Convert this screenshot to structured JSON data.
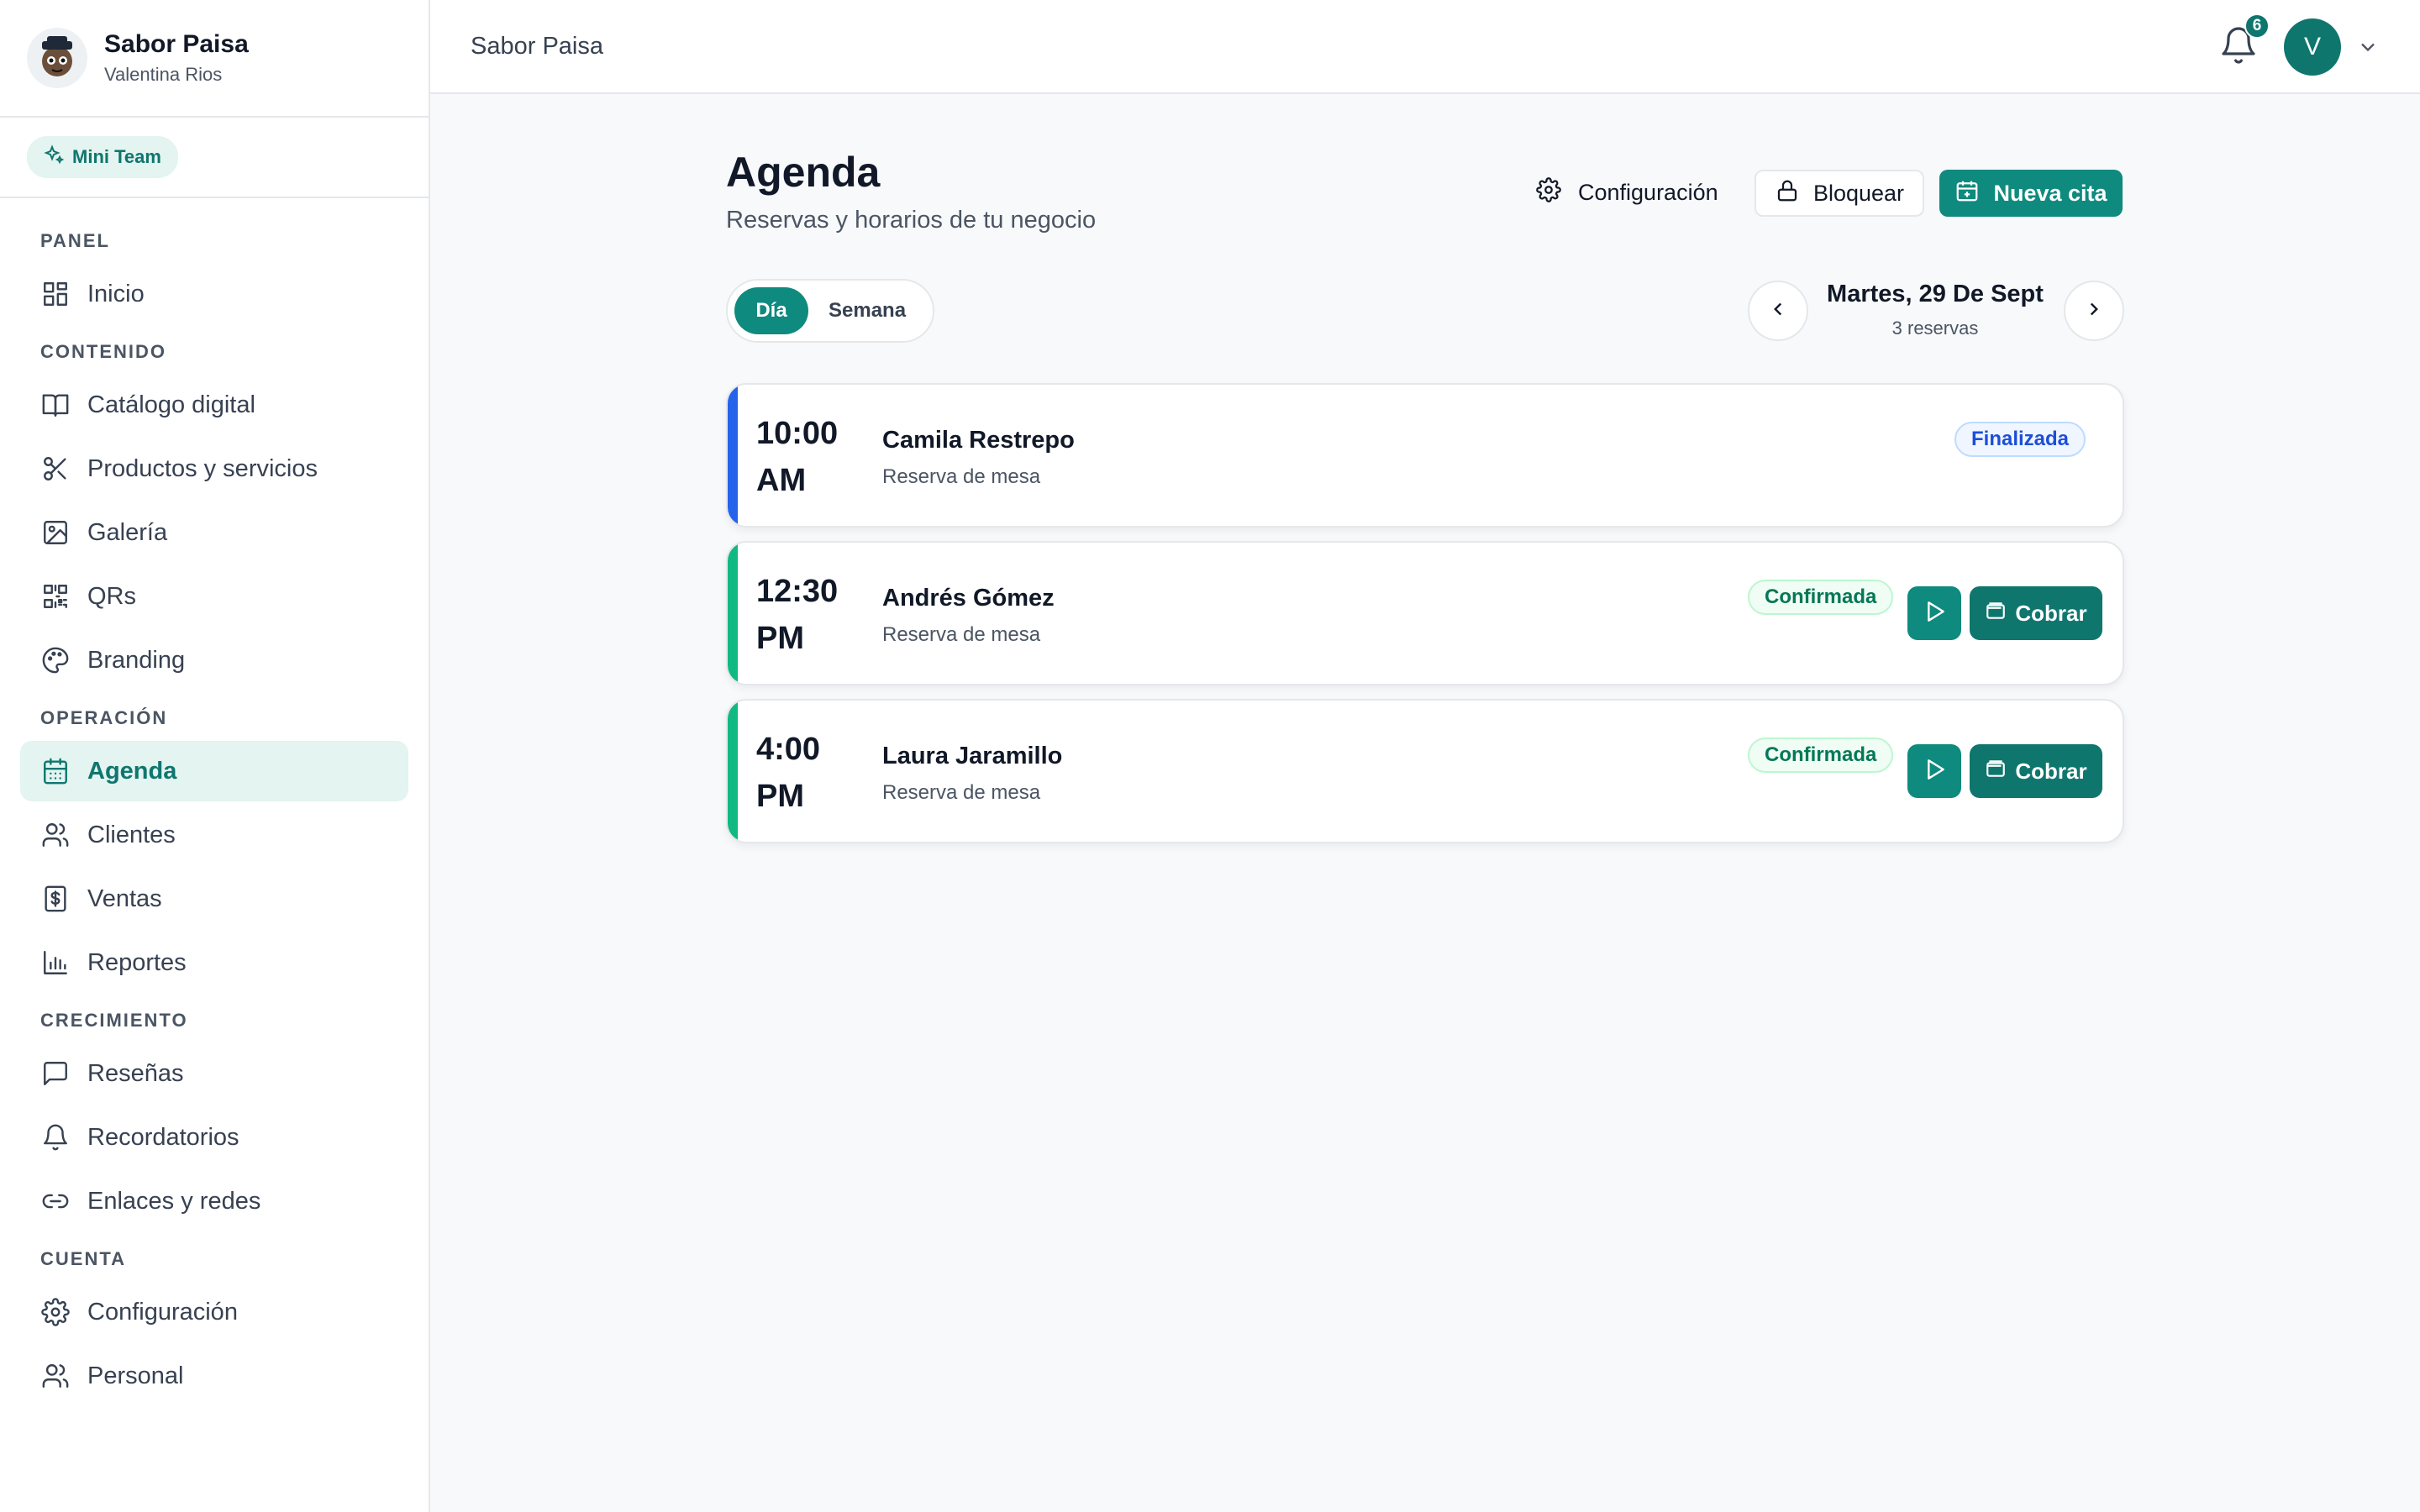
{
  "brand": {
    "name": "Sabor Paisa",
    "user": "Valentina Rios"
  },
  "team_badge": "Mini Team",
  "nav": {
    "sections": [
      {
        "title": "PANEL",
        "items": [
          {
            "label": "Inicio",
            "icon": "grid-icon"
          }
        ]
      },
      {
        "title": "CONTENIDO",
        "items": [
          {
            "label": "Catálogo digital",
            "icon": "book-icon"
          },
          {
            "label": "Productos y servicios",
            "icon": "scissors-icon"
          },
          {
            "label": "Galería",
            "icon": "image-icon"
          },
          {
            "label": "QRs",
            "icon": "qr-icon"
          },
          {
            "label": "Branding",
            "icon": "palette-icon"
          }
        ]
      },
      {
        "title": "OPERACIÓN",
        "items": [
          {
            "label": "Agenda",
            "icon": "calendar-icon",
            "active": true
          },
          {
            "label": "Clientes",
            "icon": "users-icon"
          },
          {
            "label": "Ventas",
            "icon": "dollar-icon"
          },
          {
            "label": "Reportes",
            "icon": "bar-chart-icon"
          }
        ]
      },
      {
        "title": "CRECIMIENTO",
        "items": [
          {
            "label": "Reseñas",
            "icon": "message-icon"
          },
          {
            "label": "Recordatorios",
            "icon": "bell-icon"
          },
          {
            "label": "Enlaces y redes",
            "icon": "link-icon"
          }
        ]
      },
      {
        "title": "CUENTA",
        "items": [
          {
            "label": "Configuración",
            "icon": "gear-icon"
          },
          {
            "label": "Personal",
            "icon": "users-icon"
          }
        ]
      }
    ]
  },
  "topbar": {
    "title": "Sabor Paisa",
    "notification_count": "6",
    "avatar_initial": "V"
  },
  "main": {
    "title": "Agenda",
    "subtitle": "Reservas y horarios de tu negocio",
    "config_label": "Configuración",
    "block_label": "Bloquear",
    "new_label": "Nueva cita",
    "view_day": "Día",
    "view_week": "Semana",
    "date_label": "Martes, 29 De Sept",
    "date_count": "3 reservas"
  },
  "appointments": [
    {
      "time": "10:00",
      "period": "AM",
      "name": "Camila Restrepo",
      "type": "Reserva de mesa",
      "status": "Finalizada",
      "status_kind": "done",
      "bar_color": "#2563eb",
      "actions": false
    },
    {
      "time": "12:30",
      "period": "PM",
      "name": "Andrés Gómez",
      "type": "Reserva de mesa",
      "status": "Confirmada",
      "status_kind": "conf",
      "bar_color": "#10b981",
      "actions": true,
      "charge_label": "Cobrar"
    },
    {
      "time": "4:00",
      "period": "PM",
      "name": "Laura Jaramillo",
      "type": "Reserva de mesa",
      "status": "Confirmada",
      "status_kind": "conf",
      "bar_color": "#10b981",
      "actions": true,
      "charge_label": "Cobrar"
    }
  ],
  "colors": {
    "accent": "#0f8a7e",
    "accent_dark": "#0f766e"
  }
}
